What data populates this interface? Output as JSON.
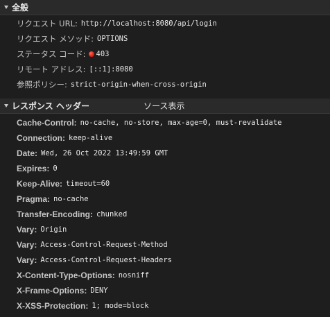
{
  "general": {
    "title": "全般",
    "rows": [
      {
        "key": "リクエスト URL:",
        "value": "http://localhost:8080/api/login"
      },
      {
        "key": "リクエスト メソッド:",
        "value": "OPTIONS"
      },
      {
        "key": "ステータス コード:",
        "value": "403",
        "status_color": "#e0251b"
      },
      {
        "key": "リモート アドレス:",
        "value": "[::1]:8080"
      },
      {
        "key": "参照ポリシー:",
        "value": "strict-origin-when-cross-origin"
      }
    ]
  },
  "response_headers": {
    "title": "レスポンス ヘッダー",
    "view_source_label": "ソース表示",
    "rows": [
      {
        "key": "Cache-Control:",
        "value": "no-cache, no-store, max-age=0, must-revalidate"
      },
      {
        "key": "Connection:",
        "value": "keep-alive"
      },
      {
        "key": "Date:",
        "value": "Wed, 26 Oct 2022 13:49:59 GMT"
      },
      {
        "key": "Expires:",
        "value": "0"
      },
      {
        "key": "Keep-Alive:",
        "value": "timeout=60"
      },
      {
        "key": "Pragma:",
        "value": "no-cache"
      },
      {
        "key": "Transfer-Encoding:",
        "value": "chunked"
      },
      {
        "key": "Vary:",
        "value": "Origin"
      },
      {
        "key": "Vary:",
        "value": "Access-Control-Request-Method"
      },
      {
        "key": "Vary:",
        "value": "Access-Control-Request-Headers"
      },
      {
        "key": "X-Content-Type-Options:",
        "value": "nosniff"
      },
      {
        "key": "X-Frame-Options:",
        "value": "DENY"
      },
      {
        "key": "X-XSS-Protection:",
        "value": "1; mode=block"
      }
    ]
  },
  "colors": {
    "background": "#1e1e1e",
    "section_header_bg": "#2a2a2a",
    "status_red": "#e0251b"
  },
  "icons": {
    "section_toggle": "triangle-down-icon"
  }
}
